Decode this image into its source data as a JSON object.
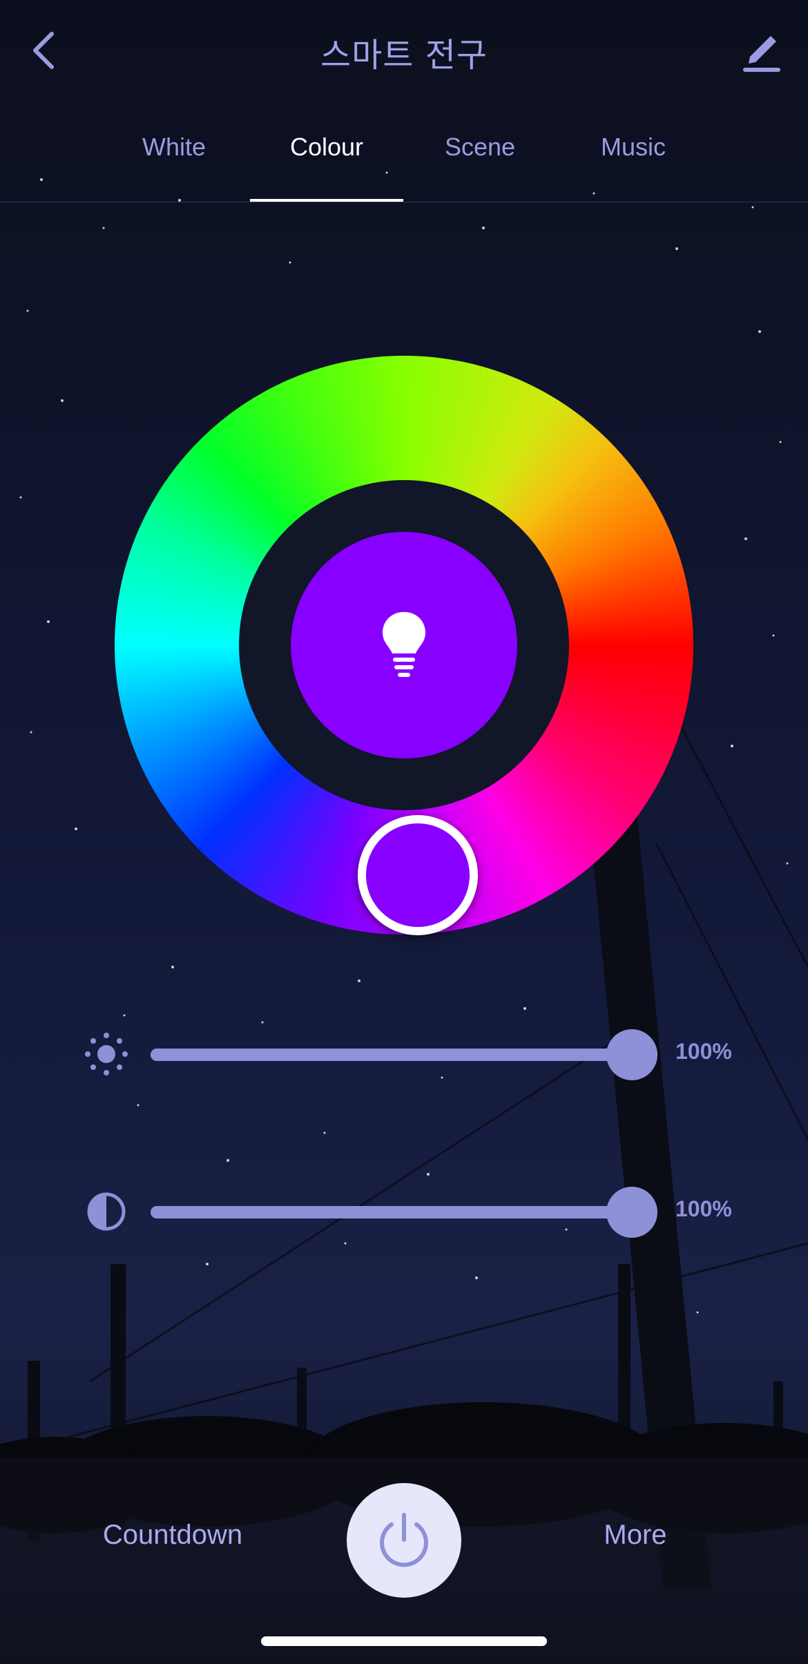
{
  "header": {
    "title": "스마트 전구",
    "back_icon": "chevron-left-icon",
    "edit_icon": "pencil-icon"
  },
  "tabs": [
    {
      "label": "White",
      "active": false
    },
    {
      "label": "Colour",
      "active": true
    },
    {
      "label": "Scene",
      "active": false
    },
    {
      "label": "Music",
      "active": false
    }
  ],
  "color_wheel": {
    "selected_color": "#8800ff",
    "center_icon": "lightbulb-icon"
  },
  "sliders": {
    "brightness": {
      "icon": "sun-icon",
      "value": "100%",
      "level": 1.0
    },
    "saturation": {
      "icon": "contrast-icon",
      "value": "100%",
      "level": 1.0
    }
  },
  "bottom_bar": {
    "countdown_label": "Countdown",
    "more_label": "More",
    "power_icon": "power-icon"
  },
  "colors": {
    "accent": "#8e91d8",
    "tab_inactive": "#9a9be0",
    "tab_active": "#ffffff",
    "power_button_bg": "#e6e7fb"
  }
}
